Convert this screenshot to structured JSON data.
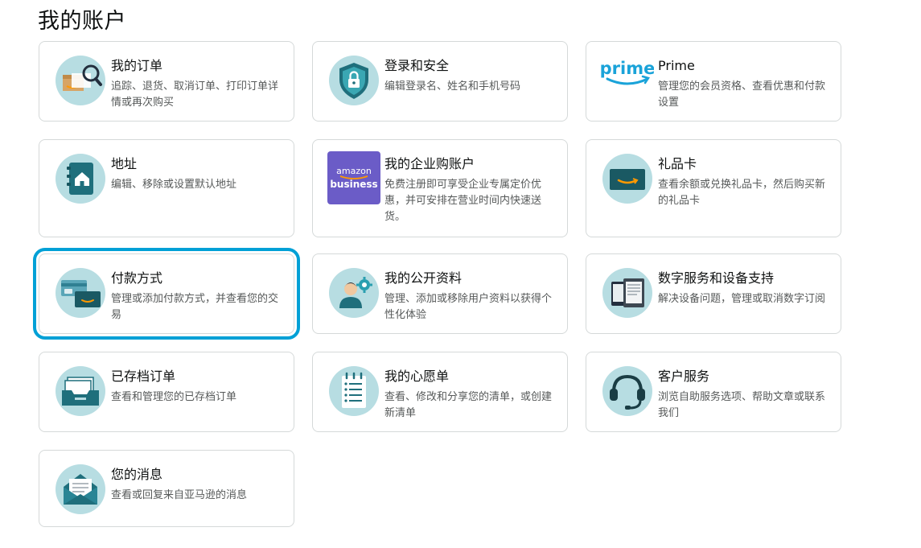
{
  "page": {
    "title": "我的账户"
  },
  "cards": [
    {
      "title": "我的订单",
      "desc": "追踪、退货、取消订单、打印订单详情或再次购买",
      "icon": "orders-package-icon"
    },
    {
      "title": "登录和安全",
      "desc": "编辑登录名、姓名和手机号码",
      "icon": "security-shield-icon"
    },
    {
      "title": "Prime",
      "desc": "管理您的会员资格、查看优惠和付款设置",
      "icon": "prime-logo",
      "logo_text": "prime"
    },
    {
      "title": "地址",
      "desc": "编辑、移除或设置默认地址",
      "icon": "address-book-icon"
    },
    {
      "title": "我的企业购账户",
      "desc": "免费注册即可享受企业专属定价优惠，并可安排在营业时间内快速送货。",
      "icon": "amazon-business-logo",
      "logo_line1": "amazon",
      "logo_line2": "business"
    },
    {
      "title": "礼品卡",
      "desc": "查看余额或兑换礼品卡，然后购买新的礼品卡",
      "icon": "gift-card-icon"
    },
    {
      "title": "付款方式",
      "desc": "管理或添加付款方式，并查看您的交易",
      "icon": "payment-cards-icon",
      "selected": true
    },
    {
      "title": "我的公开资料",
      "desc": "管理、添加或移除用户资料以获得个性化体验",
      "icon": "profile-settings-icon"
    },
    {
      "title": "数字服务和设备支持",
      "desc": "解决设备问题，管理或取消数字订阅",
      "icon": "devices-icon"
    },
    {
      "title": "已存档订单",
      "desc": "查看和管理您的已存档订单",
      "icon": "archived-orders-icon"
    },
    {
      "title": "我的心愿单",
      "desc": "查看、修改和分享您的清单，或创建新清单",
      "icon": "wishlist-icon"
    },
    {
      "title": "客户服务",
      "desc": "浏览自助服务选项、帮助文章或联系我们",
      "icon": "headset-icon"
    },
    {
      "title": "您的消息",
      "desc": "查看或回复来自亚马逊的消息",
      "icon": "message-envelope-icon"
    }
  ],
  "colors": {
    "accent_blue": "#00a0d6",
    "icon_circle": "#b7dde2",
    "teal": "#1f6f7c",
    "amazon_orange": "#ff9900",
    "business_purple": "#6b5cc7"
  }
}
